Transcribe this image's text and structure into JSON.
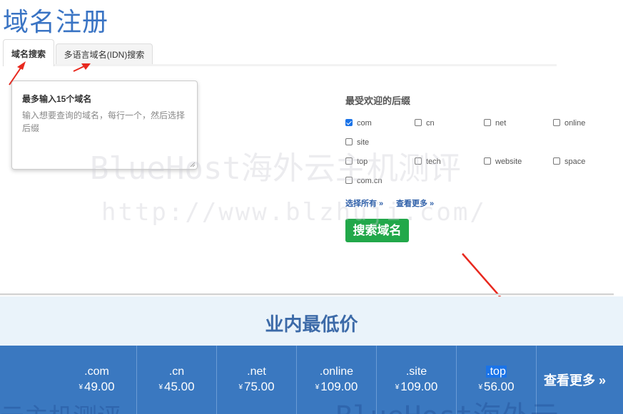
{
  "page": {
    "title": "域名注册"
  },
  "tabs": [
    {
      "label": "域名搜索",
      "active": true
    },
    {
      "label": "多语言域名(IDN)搜索",
      "active": false
    }
  ],
  "domain_input": {
    "label": "最多输入15个域名",
    "placeholder": "输入想要查询的域名，每行一个，然后选择后缀"
  },
  "suffixes": {
    "title": "最受欢迎的后缀",
    "items": [
      {
        "label": "com",
        "checked": true
      },
      {
        "label": "cn",
        "checked": false
      },
      {
        "label": "net",
        "checked": false
      },
      {
        "label": "online",
        "checked": false
      },
      {
        "label": "site",
        "checked": false
      },
      {
        "label": "top",
        "checked": false
      },
      {
        "label": "tech",
        "checked": false
      },
      {
        "label": "website",
        "checked": false
      },
      {
        "label": "space",
        "checked": false
      },
      {
        "label": "com.cn",
        "checked": false
      }
    ],
    "select_all": "选择所有 »",
    "see_more": "查看更多 »"
  },
  "search_button": "搜索域名",
  "prices": {
    "heading": "业内最低价",
    "currency": "¥",
    "items": [
      {
        "ext": ".com",
        "price": "49.00"
      },
      {
        "ext": ".cn",
        "price": "45.00"
      },
      {
        "ext": ".net",
        "price": "75.00"
      },
      {
        "ext": ".online",
        "price": "109.00"
      },
      {
        "ext": ".site",
        "price": "109.00"
      },
      {
        "ext": ".top",
        "price": "56.00"
      }
    ],
    "more_label": "查看更多 »"
  },
  "watermark": {
    "line1": "BlueHost海外云主机测评",
    "line2": "http://www.blzhuji.com/",
    "line3": "云主机测评",
    "line4": "BlueHost海外云"
  },
  "colors": {
    "accent": "#3a74c4",
    "button_green": "#22a84a",
    "price_bar": "#3a78c0",
    "annotation_arrow": "#e8281e"
  }
}
